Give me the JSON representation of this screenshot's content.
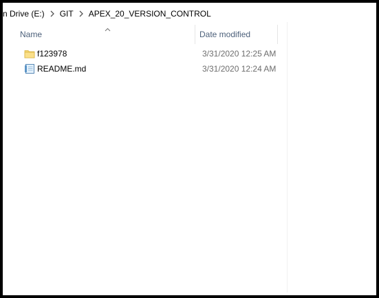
{
  "breadcrumb": {
    "items": [
      "n Drive (E:)",
      "GIT",
      "APEX_20_VERSION_CONTROL"
    ],
    "separator_icon": "chevron-right-icon"
  },
  "columns": {
    "name": "Name",
    "date_modified": "Date modified",
    "sort_indicator_icon": "chevron-up-icon"
  },
  "files": [
    {
      "name": "f123978",
      "date": "3/31/2020 12:25 AM",
      "icon": "folder-icon"
    },
    {
      "name": "README.md",
      "date": "3/31/2020 12:24 AM",
      "icon": "text-file-icon"
    }
  ],
  "colors": {
    "frame_border": "#000000",
    "header_text": "#4c607a",
    "date_text": "#6d6d6d",
    "folder_yellow": "#f5d46b"
  }
}
